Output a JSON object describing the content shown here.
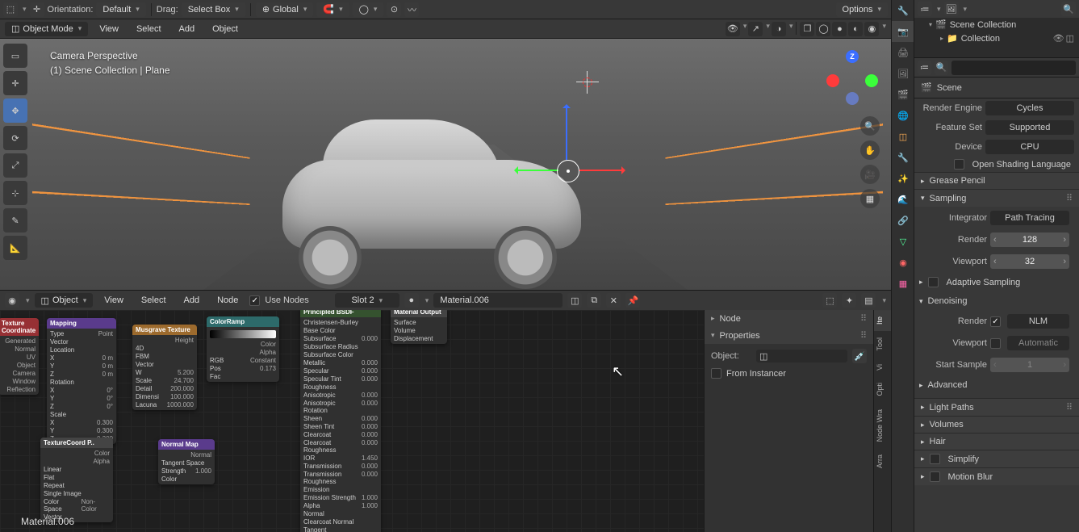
{
  "viewport_header": {
    "orientation_label": "Orientation:",
    "orientation_value": "Default",
    "drag_label": "Drag:",
    "drag_value": "Select Box",
    "transform_value": "Global",
    "options_label": "Options"
  },
  "viewport_header2": {
    "mode": "Object Mode",
    "menus": [
      "View",
      "Select",
      "Add",
      "Object"
    ]
  },
  "viewport_overlay": {
    "line1": "Camera Perspective",
    "line2": "(1) Scene Collection | Plane"
  },
  "tools": [
    "select-box",
    "cursor",
    "move",
    "rotate",
    "scale",
    "transform",
    "annotate",
    "measure"
  ],
  "gizmo_axes": {
    "x": "X",
    "y": "Y",
    "z": "Z"
  },
  "node_editor": {
    "header": {
      "mode": "Object",
      "menus": [
        "View",
        "Select",
        "Add",
        "Node"
      ],
      "use_nodes_label": "Use Nodes",
      "use_nodes_checked": true,
      "slot": "Slot 2",
      "material_name": "Material.006"
    },
    "sidebar": {
      "node_panel": "Node",
      "properties_panel": "Properties",
      "object_label": "Object:",
      "from_instancer_label": "From Instancer",
      "from_instancer_checked": false
    },
    "side_tabs": [
      "Item",
      "Tool",
      "View",
      "Options",
      "Node Wrangler",
      "Arrange"
    ],
    "side_tabs_short": [
      "Ite",
      "Tool",
      "Vi",
      "Opti",
      "Node Wra",
      "Arra"
    ],
    "material_label": "Material.006",
    "nodes": {
      "tex_coord": {
        "title": "Texture Coordinate",
        "outputs": [
          "Generated",
          "Normal",
          "UV",
          "Object",
          "Camera",
          "Window",
          "Reflection"
        ]
      },
      "mapping": {
        "title": "Mapping",
        "rows": [
          [
            "Type",
            "Point"
          ],
          [
            "Vector",
            ""
          ],
          [
            "Location",
            ""
          ],
          [
            "X",
            "0 m"
          ],
          [
            "Y",
            "0 m"
          ],
          [
            "Z",
            "0 m"
          ],
          [
            "Rotation",
            ""
          ],
          [
            "X",
            "0°"
          ],
          [
            "Y",
            "0°"
          ],
          [
            "Z",
            "0°"
          ],
          [
            "Scale",
            ""
          ],
          [
            "X",
            "0.300"
          ],
          [
            "Y",
            "0.300"
          ],
          [
            "Z",
            "0.300"
          ]
        ]
      },
      "musgrave": {
        "title": "Musgrave Texture",
        "rows": [
          [
            "",
            "Height"
          ],
          [
            "4D",
            ""
          ],
          [
            "FBM",
            ""
          ],
          [
            "Vector",
            ""
          ],
          [
            "W",
            "5.200"
          ],
          [
            "Scale",
            "24.700"
          ],
          [
            "Detail",
            "200.000"
          ],
          [
            "Dimensi",
            "100.000"
          ],
          [
            "Lacuna",
            "1000.000"
          ]
        ]
      },
      "colorramp": {
        "title": "ColorRamp",
        "rows": [
          [
            "",
            "Color"
          ],
          [
            "",
            "Alpha"
          ],
          [
            "RGB",
            "Constant"
          ],
          [
            "Pos",
            "0.173"
          ],
          [
            "Fac",
            ""
          ]
        ]
      },
      "normalmap": {
        "title": "Normal Map",
        "rows": [
          [
            "",
            "Normal"
          ],
          [
            "Tangent Space",
            ""
          ],
          [
            "Strength",
            "1.000"
          ],
          [
            "Color",
            ""
          ]
        ]
      },
      "texcoord2": {
        "title": "TextureCoord P..",
        "rows": [
          [
            "",
            "Color"
          ],
          [
            "",
            "Alpha"
          ],
          [
            "Linear",
            ""
          ],
          [
            "Flat",
            ""
          ],
          [
            "Repeat",
            ""
          ],
          [
            "Single Image",
            ""
          ],
          [
            "Color Space",
            "Non-Color"
          ],
          [
            "Vector",
            ""
          ]
        ]
      },
      "bsdf": {
        "title": "Principled BSDF",
        "rows": [
          [
            "Christensen-Burley",
            ""
          ],
          [
            "Base Color",
            ""
          ],
          [
            "Subsurface",
            "0.000"
          ],
          [
            "Subsurface Radius",
            ""
          ],
          [
            "Subsurface Color",
            ""
          ],
          [
            "Metallic",
            "0.000"
          ],
          [
            "Specular",
            "0.000"
          ],
          [
            "Specular Tint",
            "0.000"
          ],
          [
            "Roughness",
            ""
          ],
          [
            "Anisotropic",
            "0.000"
          ],
          [
            "Anisotropic Rotation",
            "0.000"
          ],
          [
            "Sheen",
            "0.000"
          ],
          [
            "Sheen Tint",
            "0.000"
          ],
          [
            "Clearcoat",
            "0.000"
          ],
          [
            "Clearcoat Roughness",
            "0.000"
          ],
          [
            "IOR",
            "1.450"
          ],
          [
            "Transmission",
            "0.000"
          ],
          [
            "Transmission Roughness",
            "0.000"
          ],
          [
            "Emission",
            ""
          ],
          [
            "Emission Strength",
            "1.000"
          ],
          [
            "Alpha",
            "1.000"
          ],
          [
            "Normal",
            ""
          ],
          [
            "Clearcoat Normal",
            ""
          ],
          [
            "Tangent",
            ""
          ]
        ]
      },
      "output": {
        "title": "Material Output",
        "rows": [
          [
            "Surface",
            ""
          ],
          [
            "Volume",
            ""
          ],
          [
            "Displacement",
            ""
          ]
        ]
      }
    }
  },
  "outliner": {
    "root": "Scene Collection",
    "collection": "Collection"
  },
  "scene_name": "Scene",
  "properties": {
    "render_engine_label": "Render Engine",
    "render_engine_value": "Cycles",
    "feature_set_label": "Feature Set",
    "feature_set_value": "Supported",
    "device_label": "Device",
    "device_value": "CPU",
    "osl_label": "Open Shading Language",
    "osl_checked": false,
    "panels": {
      "grease_pencil": "Grease Pencil",
      "sampling": "Sampling",
      "integrator_label": "Integrator",
      "integrator_value": "Path Tracing",
      "render_label": "Render",
      "render_value": "128",
      "viewport_label": "Viewport",
      "viewport_value": "32",
      "adaptive_label": "Adaptive Sampling",
      "adaptive_checked": false,
      "denoising": "Denoising",
      "denoise_render_label": "Render",
      "denoise_render_checked": true,
      "denoise_render_value": "NLM",
      "denoise_viewport_label": "Viewport",
      "denoise_viewport_checked": false,
      "denoise_viewport_value": "Automatic",
      "start_sample_label": "Start Sample",
      "start_sample_value": "1",
      "advanced": "Advanced",
      "light_paths": "Light Paths",
      "volumes": "Volumes",
      "hair": "Hair",
      "simplify": "Simplify",
      "motion_blur": "Motion Blur"
    }
  },
  "property_tabs": [
    "render",
    "output",
    "view-layer",
    "scene",
    "world",
    "object",
    "modifier",
    "particle",
    "physics",
    "constraint",
    "data",
    "material",
    "texture"
  ],
  "colors": {
    "accent": "#4772b3",
    "x": "#ff3b3b",
    "y": "#3bff3b",
    "z": "#3b6eff"
  }
}
